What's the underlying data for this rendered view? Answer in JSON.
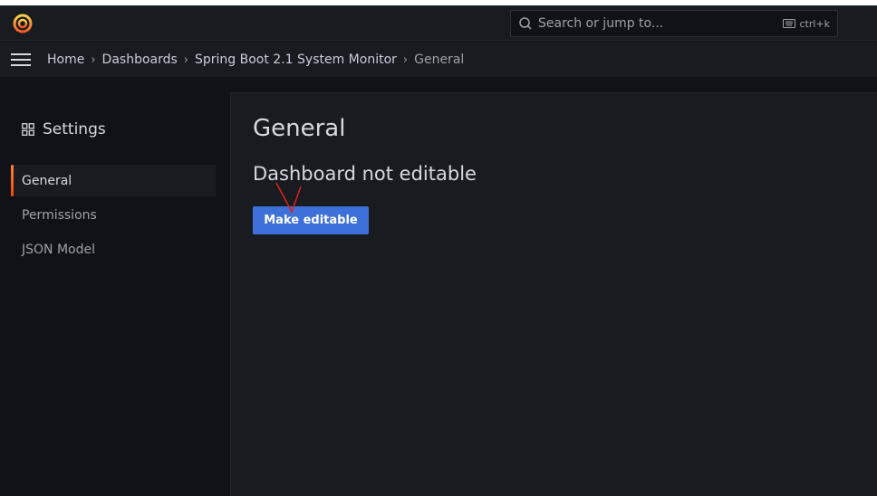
{
  "topbar": {
    "logo_icon": "grafana-logo-icon",
    "search": {
      "placeholder": "Search or jump to...",
      "shortcut": "ctrl+k"
    }
  },
  "breadcrumbs": [
    "Home",
    "Dashboards",
    "Spring Boot 2.1 System Monitor",
    "General"
  ],
  "sidebar": {
    "title": "Settings",
    "items": [
      {
        "label": "General",
        "active": true
      },
      {
        "label": "Permissions",
        "active": false
      },
      {
        "label": "JSON Model",
        "active": false
      }
    ]
  },
  "main": {
    "title": "General",
    "notice": "Dashboard not editable",
    "make_editable_label": "Make editable"
  },
  "colors": {
    "accent": "#3d71d9",
    "active_marker": "#f24c00",
    "background": "#111217",
    "panel": "#181b1f"
  }
}
